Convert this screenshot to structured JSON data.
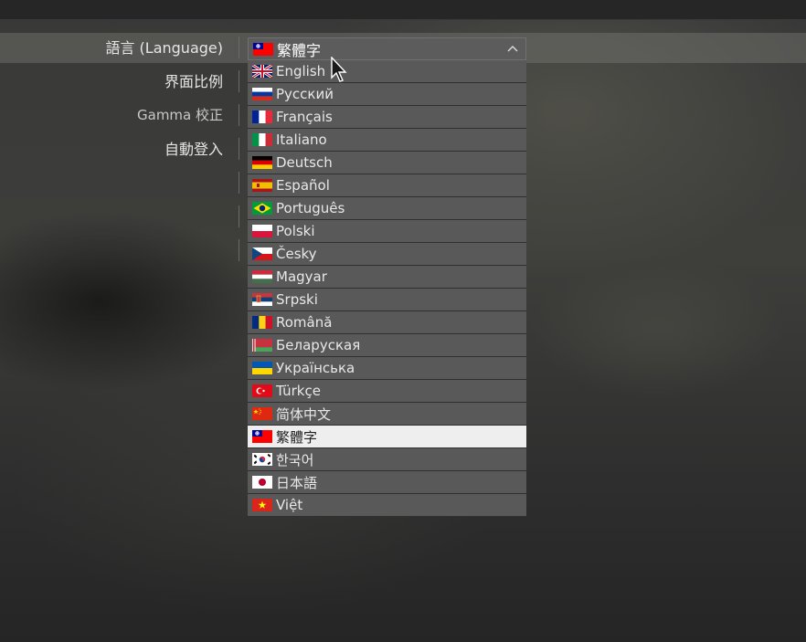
{
  "settings": {
    "labels": [
      {
        "text": "語言 (Language)"
      },
      {
        "text": "界面比例"
      },
      {
        "text": "Gamma 校正"
      },
      {
        "text": "自動登入"
      }
    ]
  },
  "dropdown": {
    "selected": "繁體字",
    "selected_flag": "taiwan-flag",
    "chevron_icon": "chevron-up-icon",
    "options": [
      {
        "label": "English",
        "flag": "uk-flag"
      },
      {
        "label": "Русский",
        "flag": "russia-flag"
      },
      {
        "label": "Français",
        "flag": "france-flag"
      },
      {
        "label": "Italiano",
        "flag": "italy-flag"
      },
      {
        "label": "Deutsch",
        "flag": "germany-flag"
      },
      {
        "label": "Español",
        "flag": "spain-flag"
      },
      {
        "label": "Português",
        "flag": "brazil-flag"
      },
      {
        "label": "Polski",
        "flag": "poland-flag"
      },
      {
        "label": "Česky",
        "flag": "czech-flag"
      },
      {
        "label": "Magyar",
        "flag": "hungary-flag"
      },
      {
        "label": "Srpski",
        "flag": "serbia-flag"
      },
      {
        "label": "Română",
        "flag": "romania-flag"
      },
      {
        "label": "Беларуская",
        "flag": "belarus-flag"
      },
      {
        "label": "Українська",
        "flag": "ukraine-flag"
      },
      {
        "label": "Türkçe",
        "flag": "turkey-flag"
      },
      {
        "label": "简体中文",
        "flag": "china-flag"
      },
      {
        "label": "繁體字",
        "flag": "taiwan-flag",
        "selected": true
      },
      {
        "label": "한국어",
        "flag": "korea-flag"
      },
      {
        "label": "日本語",
        "flag": "japan-flag"
      },
      {
        "label": "Việt",
        "flag": "vietnam-flag"
      }
    ]
  },
  "colors": {
    "item_bg": "#595959",
    "selected_bg": "#eeeeee",
    "text": "#e8e8e8"
  }
}
